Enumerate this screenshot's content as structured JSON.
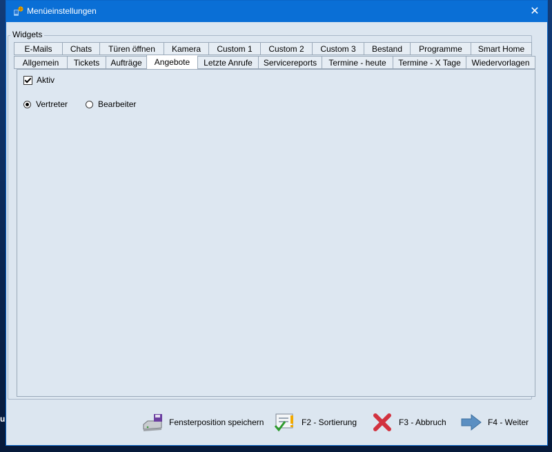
{
  "window": {
    "title": "Menüeinstellungen"
  },
  "background": {
    "sliver": "u"
  },
  "group": {
    "label": "Widgets"
  },
  "tabs_row1": [
    "E-Mails",
    "Chats",
    "Türen öffnen",
    "Kamera",
    "Custom 1",
    "Custom 2",
    "Custom 3",
    "Bestand",
    "Programme",
    "Smart Home"
  ],
  "tabs_row2": [
    "Allgemein",
    "Tickets",
    "Aufträge",
    "Angebote",
    "Letzte Anrufe",
    "Servicereports",
    "Termine - heute",
    "Termine - X Tage",
    "Wiedervorlagen"
  ],
  "active_tab": "Angebote",
  "content": {
    "aktiv_label": "Aktiv",
    "aktiv_checked": true,
    "radio_vertreter": "Vertreter",
    "radio_bearbeiter": "Bearbeiter",
    "radio_selected": "Vertreter"
  },
  "footer": {
    "save_position": "Fensterposition speichern",
    "sort": "F2 - Sortierung",
    "cancel": "F3 - Abbruch",
    "next": "F4 - Weiter"
  }
}
